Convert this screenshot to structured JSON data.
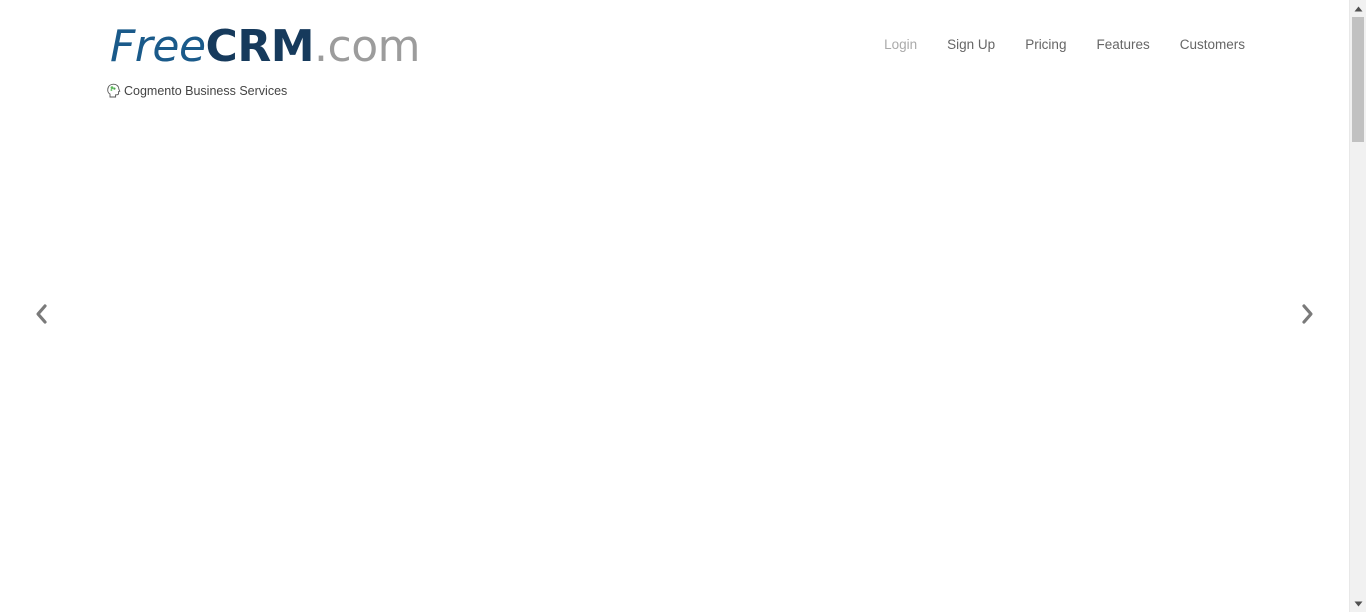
{
  "header": {
    "logo": {
      "free": "Free",
      "crm": "CRM",
      "dotcom": ".com"
    },
    "tagline": {
      "icon": "head-icon",
      "text": "Cogmento Business Services"
    }
  },
  "nav": {
    "items": [
      {
        "label": "Login"
      },
      {
        "label": "Sign Up"
      },
      {
        "label": "Pricing"
      },
      {
        "label": "Features"
      },
      {
        "label": "Customers"
      }
    ]
  },
  "carousel": {
    "prev_icon": "chevron-left-icon",
    "next_icon": "chevron-right-icon"
  },
  "colors": {
    "logo_free": "#1a5a8a",
    "logo_crm": "#163a5c",
    "logo_dotcom": "#9c9c9c",
    "nav_text": "#666666",
    "nav_login": "#aaaaaa",
    "arrow": "#7a7a7a"
  }
}
